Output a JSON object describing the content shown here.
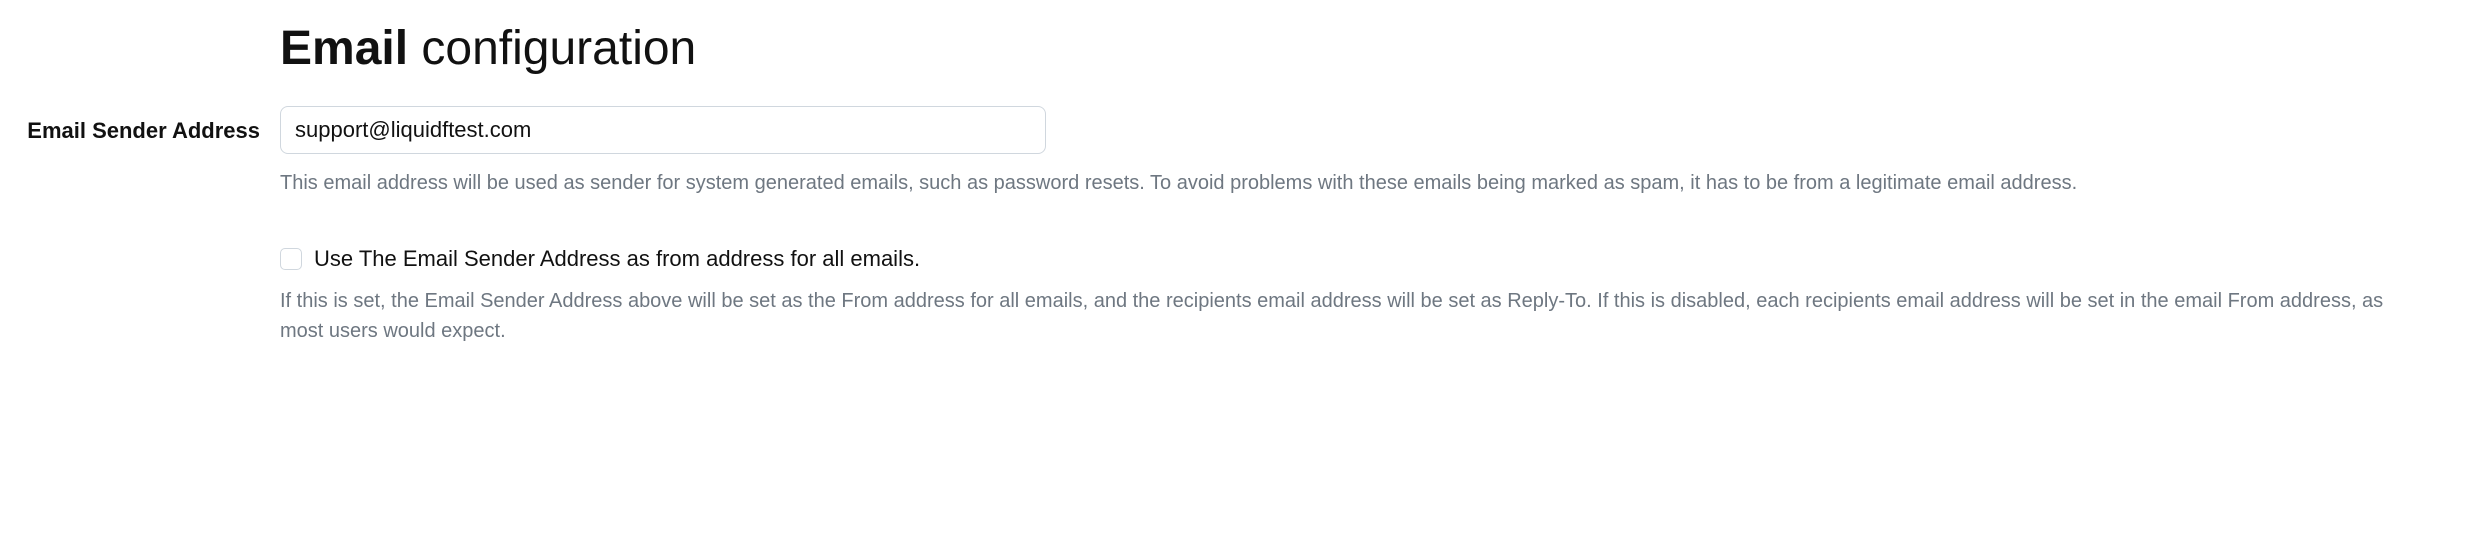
{
  "heading": {
    "bold": "Email",
    "rest": " configuration"
  },
  "sender": {
    "label": "Email Sender Address",
    "value": "support@liquidftest.com",
    "help": "This email address will be used as sender for system generated emails, such as password resets. To avoid problems with these emails being marked as spam, it has to be from a legitimate email address."
  },
  "use_as_from": {
    "checked": false,
    "label": "Use The Email Sender Address as from address for all emails.",
    "help": "If this is set, the Email Sender Address above will be set as the From address for all emails, and the recipients email address will be set as Reply-To. If this is disabled, each recipients email address will be set in the email From address, as most users would expect."
  }
}
